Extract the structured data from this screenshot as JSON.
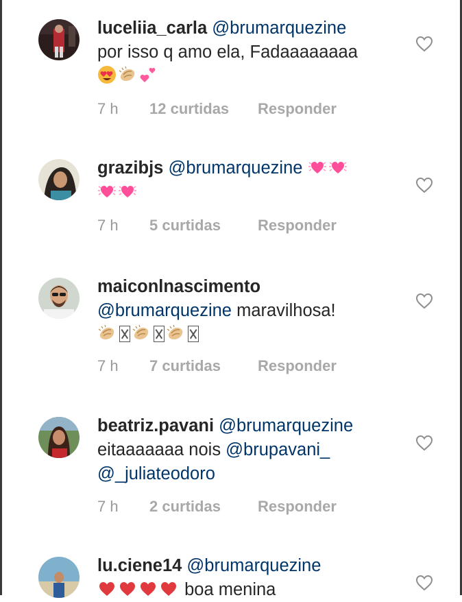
{
  "comments": [
    {
      "username": "luceliia_carla",
      "lines": [
        [
          {
            "type": "mention",
            "text": "@brumarquezine"
          }
        ],
        [
          {
            "type": "text",
            "text": "por isso q amo ela, Fadaaaaaaaa"
          }
        ],
        [
          {
            "type": "emoji",
            "icon": "heart-eyes-emoji"
          },
          {
            "type": "emoji",
            "icon": "clapping-hands-emoji"
          },
          {
            "type": "emoji",
            "icon": "two-hearts-emoji"
          }
        ]
      ],
      "time": "7 h",
      "likes": "12 curtidas",
      "reply": "Responder"
    },
    {
      "username": "grazibjs",
      "lines": [
        [
          {
            "type": "mention",
            "text": "@brumarquezine"
          },
          {
            "type": "emoji",
            "icon": "heartbeat-emoji"
          },
          {
            "type": "emoji",
            "icon": "heartbeat-emoji"
          }
        ],
        [
          {
            "type": "emoji",
            "icon": "heartbeat-emoji"
          },
          {
            "type": "emoji",
            "icon": "heartbeat-emoji"
          }
        ]
      ],
      "time": "7 h",
      "likes": "5 curtidas",
      "reply": "Responder"
    },
    {
      "username": "maiconlnascimento",
      "lines": [
        [
          {
            "type": "mention",
            "text": "@brumarquezine"
          },
          {
            "type": "text",
            "text": "maravilhosa!"
          }
        ],
        [
          {
            "type": "emoji",
            "icon": "clapping-hands-emoji"
          },
          {
            "type": "tofu"
          },
          {
            "type": "emoji",
            "icon": "clapping-hands-emoji"
          },
          {
            "type": "tofu"
          },
          {
            "type": "emoji",
            "icon": "clapping-hands-emoji"
          },
          {
            "type": "tofu"
          }
        ]
      ],
      "time": "7 h",
      "likes": "7 curtidas",
      "reply": "Responder"
    },
    {
      "username": "beatriz.pavani",
      "lines": [
        [
          {
            "type": "mention",
            "text": "@brumarquezine"
          }
        ],
        [
          {
            "type": "text",
            "text": "eitaaaaaaa nois"
          },
          {
            "type": "mention",
            "text": "@brupavani_"
          }
        ],
        [
          {
            "type": "mention",
            "text": "@_juliateodoro"
          }
        ]
      ],
      "time": "7 h",
      "likes": "2 curtidas",
      "reply": "Responder"
    },
    {
      "username": "lu.ciene14",
      "lines": [
        [
          {
            "type": "mention",
            "text": "@brumarquezine"
          }
        ],
        [
          {
            "type": "emoji",
            "icon": "red-heart-emoji"
          },
          {
            "type": "emoji",
            "icon": "red-heart-emoji"
          },
          {
            "type": "emoji",
            "icon": "red-heart-emoji"
          },
          {
            "type": "emoji",
            "icon": "red-heart-emoji"
          },
          {
            "type": "text",
            "text": "boa menina"
          }
        ]
      ],
      "time": "",
      "likes": "",
      "reply": ""
    }
  ],
  "colors": {
    "mention": "#003569",
    "meta": "#a8a8a8",
    "text": "#262626"
  }
}
